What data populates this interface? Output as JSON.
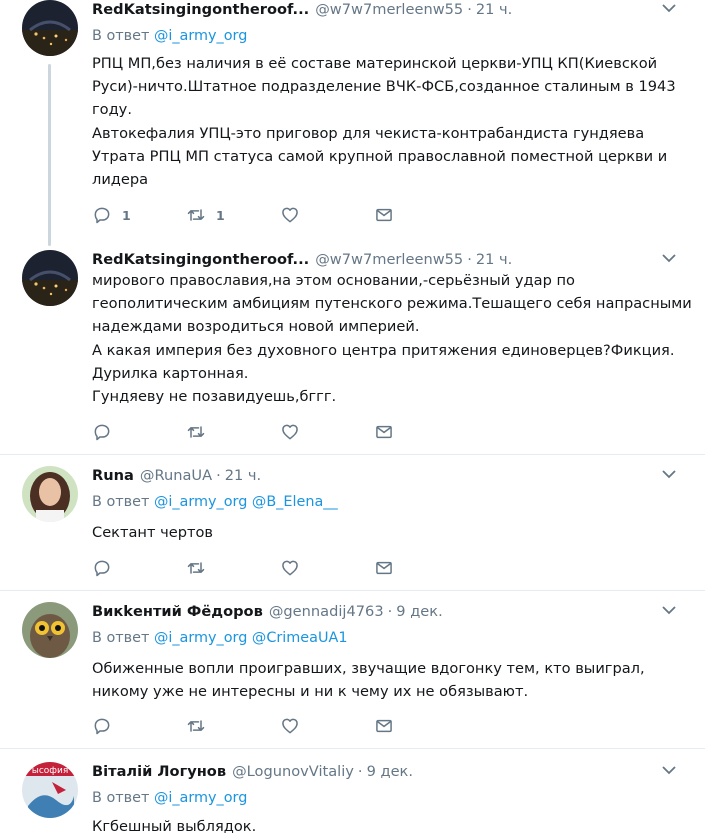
{
  "tweets": [
    {
      "name": "RedKatsingingontheroof...",
      "handle": "@w7w7merleenw55",
      "time": "21 ч.",
      "reply_prefix": "В ответ",
      "reply_mentions": [
        "@i_army_org"
      ],
      "lines": [
        "РПЦ МП,без наличия в её составе материнской церкви-УПЦ КП(Киевской",
        "Руси)-ничто.Штатное подразделение ВЧК-ФСБ,созданное сталиным в 1943",
        "году.",
        "Автокефалия УПЦ-это приговор для чекиста-контрабандиста гундяева",
        "Утрата РПЦ МП статуса самой крупной православной поместной церкви и",
        "лидера"
      ],
      "reply_count": "1",
      "retweet_count": "1"
    },
    {
      "name": "RedKatsingingontheroof...",
      "handle": "@w7w7merleenw55",
      "time": "21 ч.",
      "lines": [
        "мирового православия,на этом основании,-серьёзный удар по",
        "геополитическим амбициям путенского режима.Тешащего себя напрасными",
        "надеждами возродиться новой империей.",
        "А какая империя без духовного центра притяжения единоверцев?Фикция.",
        "Дурилка картонная.",
        "Гундяеву не позавидуешь,бггг."
      ]
    },
    {
      "name": "Runa",
      "handle": "@RunaUA",
      "time": "21 ч.",
      "reply_prefix": "В ответ",
      "reply_mentions": [
        "@i_army_org",
        "@B_Elena__"
      ],
      "lines": [
        "Сектант чертов"
      ]
    },
    {
      "name": "Викkентий Фёдоров",
      "handle": "@gennadij4763",
      "time": "9 дек.",
      "reply_prefix": "В ответ",
      "reply_mentions": [
        "@i_army_org",
        "@CrimeaUA1"
      ],
      "lines": [
        "Обиженные вопли проигравших, звучащие вдогонку тем, кто выиграл,",
        "никому уже не интересны и ни к чему их не обязывают."
      ]
    },
    {
      "name": "Віталій Логунов",
      "handle": "@LogunovVitaliy",
      "time": "9 дек.",
      "reply_prefix": "В ответ",
      "reply_mentions": [
        "@i_army_org"
      ],
      "lines": [
        "Кгбешный выблядок."
      ]
    }
  ],
  "avatar_badge_text": "ысофия",
  "dot": "·",
  "colors": {
    "text": "#14171a",
    "secondary": "#657786",
    "link": "#1b95e0",
    "divider": "#e6ecf0",
    "thread_line": "#ccd6dd"
  },
  "icons": [
    "chevron-down-icon",
    "reply-icon",
    "retweet-icon",
    "like-icon",
    "direct-message-icon"
  ]
}
